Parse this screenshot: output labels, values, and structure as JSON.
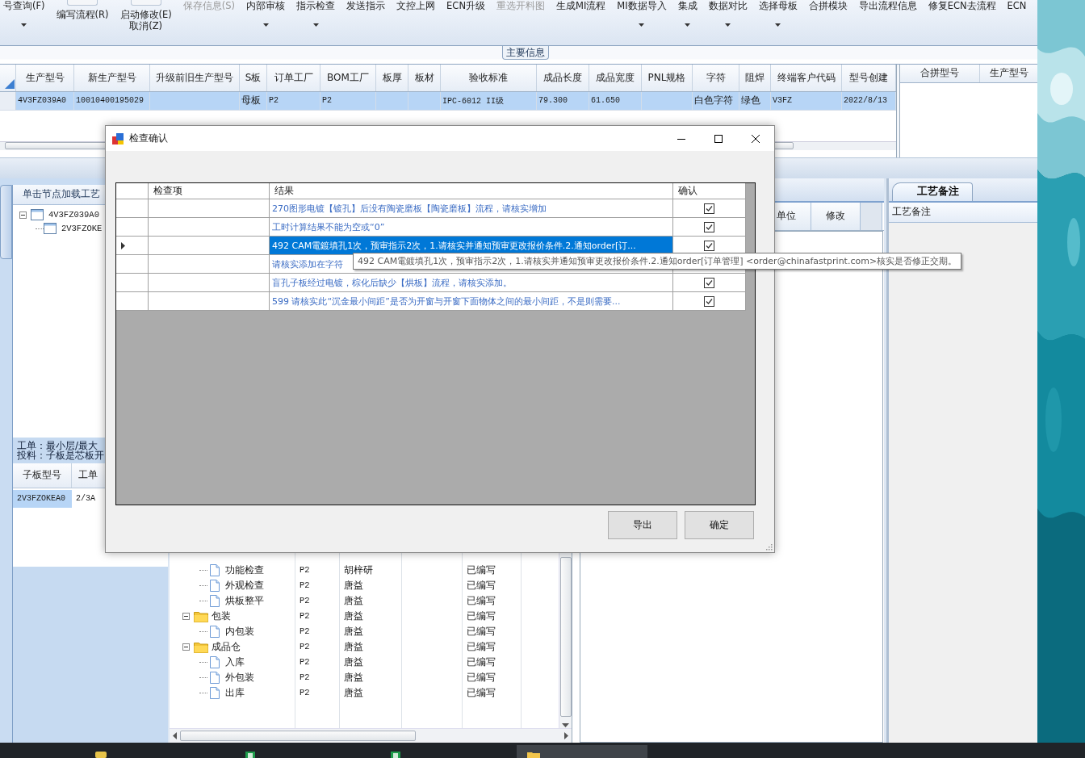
{
  "toolbar": {
    "items": [
      {
        "label": "号查询(F)",
        "kind": "small",
        "dropdown": true,
        "disabled": false
      },
      {
        "label": "编写流程(R)",
        "kind": "large",
        "dropdown": false,
        "disabled": false
      },
      {
        "label": "启动修改(E)",
        "label2": "取消(Z)",
        "kind": "large",
        "dropdown": false,
        "disabled": false
      },
      {
        "label": "保存信息(S)",
        "kind": "small",
        "dropdown": false,
        "disabled": true
      },
      {
        "label": "内部审核",
        "kind": "small",
        "dropdown": true,
        "disabled": false
      },
      {
        "label": "指示检查",
        "kind": "small",
        "dropdown": true,
        "disabled": false
      },
      {
        "label": "发送指示",
        "kind": "small",
        "dropdown": false,
        "disabled": false
      },
      {
        "label": "文控上网",
        "kind": "small",
        "dropdown": false,
        "disabled": false
      },
      {
        "label": "ECN升级",
        "kind": "small",
        "dropdown": false,
        "disabled": false
      },
      {
        "label": "重选开料图",
        "kind": "small",
        "dropdown": false,
        "disabled": true
      },
      {
        "label": "生成MI流程",
        "kind": "small",
        "dropdown": false,
        "disabled": false
      },
      {
        "label": "MI数据导入",
        "kind": "small",
        "dropdown": true,
        "disabled": false
      },
      {
        "label": "集成",
        "kind": "small",
        "dropdown": true,
        "disabled": false
      },
      {
        "label": "数据对比",
        "kind": "small",
        "dropdown": true,
        "disabled": false
      },
      {
        "label": "选择母板",
        "kind": "small",
        "dropdown": true,
        "disabled": false
      },
      {
        "label": "合拼模块",
        "kind": "small",
        "dropdown": false,
        "disabled": false
      },
      {
        "label": "导出流程信息",
        "kind": "small",
        "dropdown": false,
        "disabled": false
      },
      {
        "label": "修复ECN去流程",
        "kind": "small",
        "dropdown": false,
        "disabled": false
      },
      {
        "label": "ECN",
        "kind": "small",
        "dropdown": false,
        "disabled": false
      }
    ]
  },
  "group_title": "主要信息",
  "main_table": {
    "columns": [
      "生产型号",
      "新生产型号",
      "升级前旧生产型号",
      "S板",
      "订单工厂",
      "BOM工厂",
      "板厚",
      "板材",
      "验收标准",
      "成品长度",
      "成品宽度",
      "PNL规格",
      "字符",
      "阻焊",
      "终端客户代码",
      "型号创建"
    ],
    "rows": [
      {
        "selected": true,
        "cells": [
          "4V3FZ039A0",
          "10010400195029",
          null,
          "母板",
          "P2",
          "P2",
          null,
          null,
          "IPC-6012 II级",
          "79.300",
          "61.650",
          null,
          "白色字符",
          "绿色",
          "V3FZ",
          "2022/8/13"
        ]
      }
    ]
  },
  "merge_table": {
    "columns": [
      "合拼型号",
      "生产型号"
    ]
  },
  "left_panel": {
    "title": "单击节点加载工艺",
    "tree": [
      {
        "name": "4V3FZ039A0",
        "expanded": true,
        "children": [
          {
            "name": "2V3FZOKE"
          }
        ]
      }
    ],
    "notes": [
      "工单：最小层/最大",
      "投料：子板是芯板开"
    ],
    "table": {
      "columns": [
        "子板型号",
        "工单"
      ],
      "rows": [
        {
          "selected": true,
          "cells": [
            "2V3FZOKEA0",
            "2/3A"
          ]
        }
      ]
    }
  },
  "flow_grid": {
    "columns": [
      "单位",
      "修改"
    ]
  },
  "flow_tree": [
    {
      "children": [
        {
          "name": "功能检查",
          "factory": "P2",
          "person": "胡梓研",
          "status": "已编写"
        },
        {
          "name": "外观检查",
          "factory": "P2",
          "person": "唐益",
          "status": "已编写"
        },
        {
          "name": "烘板整平",
          "factory": "P2",
          "person": "唐益",
          "status": "已编写"
        }
      ]
    },
    {
      "name": "包装",
      "factory": "P2",
      "person": "唐益",
      "status": "已编写",
      "expanded": true,
      "children": [
        {
          "name": "内包装",
          "factory": "P2",
          "person": "唐益",
          "status": "已编写"
        }
      ]
    },
    {
      "name": "成品仓",
      "factory": "P2",
      "person": "唐益",
      "status": "已编写",
      "expanded": true,
      "children": [
        {
          "name": "入库",
          "factory": "P2",
          "person": "唐益",
          "status": "已编写"
        },
        {
          "name": "外包装",
          "factory": "P2",
          "person": "唐益",
          "status": "已编写"
        },
        {
          "name": "出库",
          "factory": "P2",
          "person": "唐益",
          "status": "已编写"
        }
      ]
    }
  ],
  "right_panel": {
    "tabs": [
      {
        "label": "工艺备注",
        "selected": true
      }
    ],
    "label": "工艺备注"
  },
  "dialog": {
    "title": "检查确认",
    "columns": [
      "检查项",
      "结果",
      "确认"
    ],
    "rows": [
      {
        "selected": false,
        "result": "270图形电镀【镀孔】后没有陶瓷磨板【陶瓷磨板】流程，请核实增加",
        "checked": true
      },
      {
        "selected": false,
        "result": "工时计算结果不能为空或“0”",
        "checked": true
      },
      {
        "selected": true,
        "result": "492 CAM電鍍填孔1次，预审指示2次，1.请核实并通知预审更改报价条件.2.通知order[订...",
        "checked": true
      },
      {
        "selected": false,
        "result": "请核实添加在字符"
      },
      {
        "selected": false,
        "result": "盲孔子板经过电镀，棕化后缺少【烘板】流程，请核实添加。",
        "checked": true
      },
      {
        "selected": false,
        "result": "599 请核实此“沉金最小间距”是否为开窗与开窗下面物体之间的最小间距，不是则需要...",
        "checked": true
      }
    ],
    "buttons": [
      "导出",
      "确定"
    ],
    "tooltip": "492 CAM電鍍填孔1次，预审指示2次，1.请核实并通知预审更改报价条件.2.通知order[订单管理] <order@chinafastprint.com>核实是否修正交期。"
  },
  "taskbar": {
    "apps": [
      {
        "kind": "app",
        "selected": false
      },
      {
        "kind": "sheet",
        "selected": false
      },
      {
        "kind": "sheet",
        "selected": false
      },
      {
        "kind": "folder",
        "selected": true
      }
    ]
  }
}
